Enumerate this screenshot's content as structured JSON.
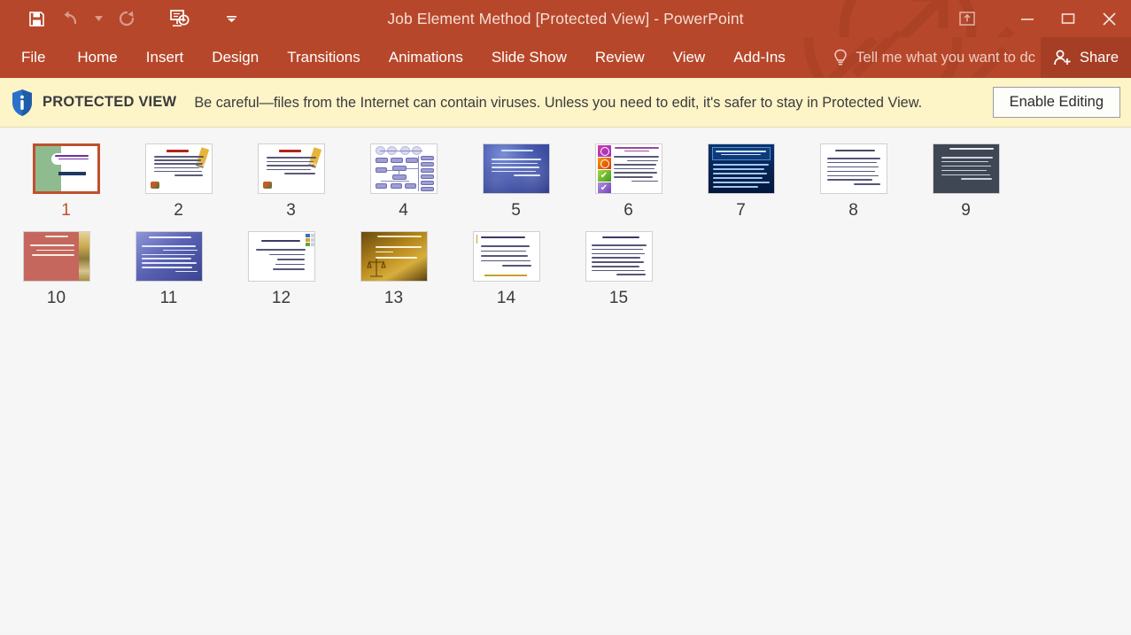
{
  "app": {
    "window_title": "Job Element Method [Protected View] - PowerPoint",
    "accent_color": "#b7472a",
    "share_bg": "#a53e24"
  },
  "quick_access": [
    {
      "name": "save",
      "icon": "save-icon",
      "enabled": true
    },
    {
      "name": "undo",
      "icon": "undo-icon",
      "enabled": false
    },
    {
      "name": "undo-dropdown",
      "icon": "chevron-down-icon",
      "enabled": false
    },
    {
      "name": "redo",
      "icon": "redo-icon",
      "enabled": false
    },
    {
      "name": "start-slideshow",
      "icon": "slideshow-icon",
      "enabled": true
    },
    {
      "name": "customize-qat",
      "icon": "chevron-down-icon",
      "enabled": true
    }
  ],
  "window_controls": [
    {
      "name": "ribbon-display-options",
      "icon": "ribbon-options-icon"
    },
    {
      "name": "minimize",
      "icon": "minimize-icon"
    },
    {
      "name": "restore",
      "icon": "restore-icon"
    },
    {
      "name": "close",
      "icon": "close-icon"
    }
  ],
  "ribbon": {
    "tabs": [
      {
        "label": "File",
        "id": "file"
      },
      {
        "label": "Home",
        "id": "home"
      },
      {
        "label": "Insert",
        "id": "insert"
      },
      {
        "label": "Design",
        "id": "design"
      },
      {
        "label": "Transitions",
        "id": "transitions"
      },
      {
        "label": "Animations",
        "id": "animations"
      },
      {
        "label": "Slide Show",
        "id": "slide-show"
      },
      {
        "label": "Review",
        "id": "review"
      },
      {
        "label": "View",
        "id": "view"
      },
      {
        "label": "Add-Ins",
        "id": "add-ins"
      }
    ],
    "tell_me": "Tell me what you want to dc",
    "tell_me_icon": "lightbulb-icon",
    "share_label": "Share",
    "share_icon": "person-add-icon"
  },
  "protected_view": {
    "icon": "info-shield-icon",
    "label": "PROTECTED VIEW",
    "message": "Be careful—files from the Internet can contain viruses. Unless you need to edit, it's safer to stay in Protected View.",
    "button_label": "Enable Editing",
    "bar_color": "#fdf4c8"
  },
  "slide_sorter": {
    "selected_slide": 1,
    "selection_color": "#c0502e",
    "slides": [
      {
        "number": "1",
        "style": "title-green",
        "selected": true
      },
      {
        "number": "2",
        "style": "note-pencil",
        "selected": false
      },
      {
        "number": "3",
        "style": "note-pencil",
        "selected": false
      },
      {
        "number": "4",
        "style": "flowchart",
        "selected": false
      },
      {
        "number": "5",
        "style": "blue-gradient",
        "selected": false
      },
      {
        "number": "6",
        "style": "icon-list",
        "selected": false
      },
      {
        "number": "7",
        "style": "navy-dark",
        "selected": false
      },
      {
        "number": "8",
        "style": "white-text",
        "selected": false
      },
      {
        "number": "9",
        "style": "slate-dark",
        "selected": false
      },
      {
        "number": "10",
        "style": "salmon-border",
        "selected": false
      },
      {
        "number": "11",
        "style": "blue-purple",
        "selected": false
      },
      {
        "number": "12",
        "style": "white-squares",
        "selected": false
      },
      {
        "number": "13",
        "style": "brown-gold",
        "selected": false
      },
      {
        "number": "14",
        "style": "white-goldline",
        "selected": false
      },
      {
        "number": "15",
        "style": "white-text",
        "selected": false
      }
    ]
  }
}
